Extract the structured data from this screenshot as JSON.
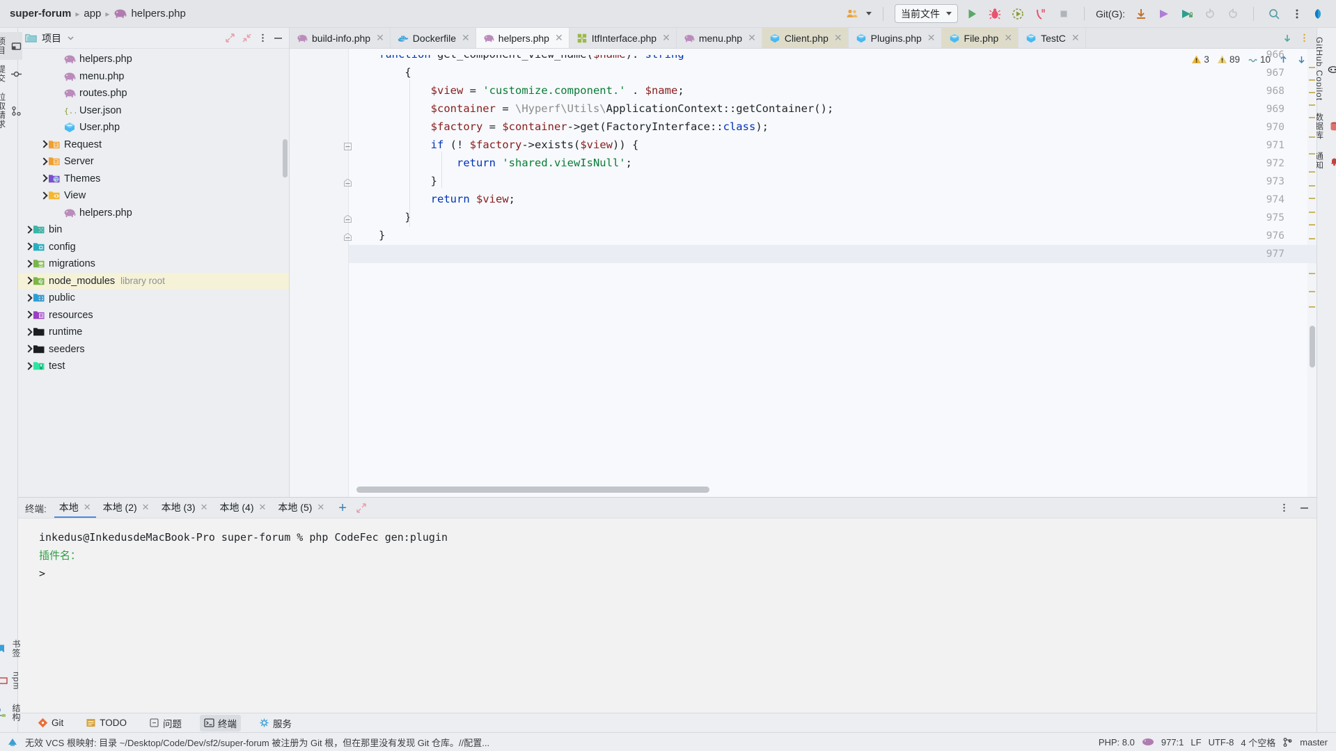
{
  "window": {
    "breadcrumb": [
      {
        "label": "super-forum",
        "icon": "",
        "bold": true
      },
      {
        "label": "app",
        "icon": "",
        "bold": false
      },
      {
        "label": "helpers.php",
        "icon": "php-elephant-icon",
        "bold": false
      }
    ]
  },
  "toolbar": {
    "run_config": "当前文件",
    "git_label": "Git(G):",
    "buttons": [
      {
        "name": "avatar-group-button",
        "icon": "people-icon"
      },
      {
        "name": "run-button",
        "icon": "play-icon"
      },
      {
        "name": "debug-button",
        "icon": "bug-icon"
      },
      {
        "name": "run-with-profiler-button",
        "icon": "profiler-icon"
      },
      {
        "name": "run-with-coverage-button",
        "icon": "coverage-icon"
      },
      {
        "name": "stop-button",
        "icon": "stop-icon"
      },
      {
        "name": "git-update-button",
        "icon": "download-arrow-icon"
      },
      {
        "name": "git-commit-button",
        "icon": "commit-arrow-icon"
      },
      {
        "name": "git-push-button",
        "icon": "push-arrow-icon"
      },
      {
        "name": "git-rollback-button",
        "icon": "undo-icon"
      },
      {
        "name": "git-redo-button",
        "icon": "redo-icon"
      },
      {
        "name": "search-everywhere-button",
        "icon": "search-icon"
      },
      {
        "name": "more-options-button",
        "icon": "kebab-menu-icon"
      },
      {
        "name": "ai-assistant-button",
        "icon": "assistant-icon"
      }
    ]
  },
  "left_rail": {
    "items": [
      {
        "label": "项目",
        "icon": "project-icon",
        "selected": true
      },
      {
        "label": "提交",
        "icon": "commit-icon",
        "selected": false
      },
      {
        "label": "拉取请求",
        "icon": "pull-request-icon",
        "selected": false
      }
    ],
    "bottom_items": [
      {
        "label": "书签",
        "icon": "bookmark-icon"
      },
      {
        "label": "npm",
        "icon": "npm-icon"
      },
      {
        "label": "结构",
        "icon": "structure-icon"
      }
    ]
  },
  "right_rail": {
    "items": [
      {
        "label": "GitHub Copilot",
        "icon": "copilot-icon"
      },
      {
        "label": "数据库",
        "icon": "database-icon"
      },
      {
        "label": "通知",
        "icon": "notifications-icon"
      }
    ]
  },
  "project": {
    "title": "项目",
    "tree": [
      {
        "label": "helpers.php",
        "icon": "php-elephant-icon",
        "indent": 3,
        "arrow": false,
        "note": ""
      },
      {
        "label": "menu.php",
        "icon": "php-elephant-icon",
        "indent": 3,
        "arrow": false,
        "note": ""
      },
      {
        "label": "routes.php",
        "icon": "php-elephant-icon",
        "indent": 3,
        "arrow": false,
        "note": ""
      },
      {
        "label": "User.json",
        "icon": "json-icon",
        "indent": 3,
        "arrow": false,
        "note": ""
      },
      {
        "label": "User.php",
        "icon": "php-class-icon",
        "indent": 3,
        "arrow": false,
        "note": ""
      },
      {
        "label": "Request",
        "icon": "folder-orange-icon",
        "indent": 2,
        "arrow": true,
        "note": ""
      },
      {
        "label": "Server",
        "icon": "folder-orange-icon",
        "indent": 2,
        "arrow": true,
        "note": ""
      },
      {
        "label": "Themes",
        "icon": "folder-purple-icon",
        "indent": 2,
        "arrow": true,
        "note": ""
      },
      {
        "label": "View",
        "icon": "folder-yellow-icon",
        "indent": 2,
        "arrow": true,
        "note": ""
      },
      {
        "label": "helpers.php",
        "icon": "php-elephant-icon",
        "indent": 3,
        "arrow": false,
        "note": ""
      },
      {
        "label": "bin",
        "icon": "folder-teal-icon",
        "indent": 1,
        "arrow": true,
        "note": ""
      },
      {
        "label": "config",
        "icon": "folder-config-icon",
        "indent": 1,
        "arrow": true,
        "note": ""
      },
      {
        "label": "migrations",
        "icon": "folder-green-icon",
        "indent": 1,
        "arrow": true,
        "note": ""
      },
      {
        "label": "node_modules",
        "icon": "folder-node-icon",
        "indent": 1,
        "arrow": true,
        "note": "library root",
        "highlighted": true
      },
      {
        "label": "public",
        "icon": "folder-blue-icon",
        "indent": 1,
        "arrow": true,
        "note": ""
      },
      {
        "label": "resources",
        "icon": "folder-violet-icon",
        "indent": 1,
        "arrow": true,
        "note": ""
      },
      {
        "label": "runtime",
        "icon": "folder-black-icon",
        "indent": 1,
        "arrow": true,
        "note": ""
      },
      {
        "label": "seeders",
        "icon": "folder-black-icon",
        "indent": 1,
        "arrow": true,
        "note": ""
      },
      {
        "label": "test",
        "icon": "folder-test-icon",
        "indent": 1,
        "arrow": true,
        "note": ""
      }
    ]
  },
  "editor": {
    "tabs": [
      {
        "label": "build-info.php",
        "icon": "php-elephant-icon",
        "active": false,
        "modified": false
      },
      {
        "label": "Dockerfile",
        "icon": "docker-icon",
        "active": false,
        "modified": false
      },
      {
        "label": "helpers.php",
        "icon": "php-elephant-icon",
        "active": true,
        "modified": false
      },
      {
        "label": "ItfInterface.php",
        "icon": "php-interface-icon",
        "active": false,
        "modified": false
      },
      {
        "label": "menu.php",
        "icon": "php-elephant-icon",
        "active": false,
        "modified": false
      },
      {
        "label": "Client.php",
        "icon": "php-class-icon",
        "active": false,
        "modified": true
      },
      {
        "label": "Plugins.php",
        "icon": "php-class-icon",
        "active": false,
        "modified": false
      },
      {
        "label": "File.php",
        "icon": "php-class-icon",
        "active": false,
        "modified": true
      },
      {
        "label": "TestC",
        "icon": "php-class-icon",
        "active": false,
        "modified": false
      }
    ],
    "inspections": {
      "warnings_strong": "3",
      "warnings_weak": "89",
      "weak_warnings": "10"
    },
    "lines": [
      {
        "num": "966",
        "clipped": true,
        "tokens": [
          {
            "t": "function ",
            "c": "c-kw"
          },
          {
            "t": "get_component_view_name",
            "c": "c-fn"
          },
          {
            "t": "(",
            "c": ""
          },
          {
            "t": "$name",
            "c": "c-var"
          },
          {
            "t": "): ",
            "c": ""
          },
          {
            "t": "string",
            "c": "c-kw"
          }
        ],
        "indent": 0
      },
      {
        "num": "967",
        "tokens": [
          {
            "t": "{",
            "c": ""
          }
        ],
        "indent": 1
      },
      {
        "num": "968",
        "tokens": [
          {
            "t": "$view",
            "c": "c-var"
          },
          {
            "t": " = ",
            "c": ""
          },
          {
            "t": "'customize.component.'",
            "c": "c-str"
          },
          {
            "t": " . ",
            "c": ""
          },
          {
            "t": "$name",
            "c": "c-var"
          },
          {
            "t": ";",
            "c": ""
          }
        ],
        "indent": 2
      },
      {
        "num": "969",
        "tokens": [
          {
            "t": "$container",
            "c": "c-var"
          },
          {
            "t": " = ",
            "c": ""
          },
          {
            "t": "\\Hyperf\\Utils\\",
            "c": "c-ns"
          },
          {
            "t": "ApplicationContext",
            "c": "c-cls"
          },
          {
            "t": "::",
            "c": ""
          },
          {
            "t": "getContainer",
            "c": "c-fn"
          },
          {
            "t": "();",
            "c": ""
          }
        ],
        "indent": 2
      },
      {
        "num": "970",
        "tokens": [
          {
            "t": "$factory",
            "c": "c-var"
          },
          {
            "t": " = ",
            "c": ""
          },
          {
            "t": "$container",
            "c": "c-var"
          },
          {
            "t": "->",
            "c": ""
          },
          {
            "t": "get",
            "c": "c-fn"
          },
          {
            "t": "(",
            "c": ""
          },
          {
            "t": "FactoryInterface",
            "c": "c-cls"
          },
          {
            "t": "::",
            "c": ""
          },
          {
            "t": "class",
            "c": "c-kw"
          },
          {
            "t": ");",
            "c": ""
          }
        ],
        "indent": 2
      },
      {
        "num": "971",
        "fold": "minus",
        "tokens": [
          {
            "t": "if",
            "c": "c-kw"
          },
          {
            "t": " (! ",
            "c": ""
          },
          {
            "t": "$factory",
            "c": "c-var"
          },
          {
            "t": "->",
            "c": ""
          },
          {
            "t": "exists",
            "c": "c-fn"
          },
          {
            "t": "(",
            "c": ""
          },
          {
            "t": "$view",
            "c": "c-var"
          },
          {
            "t": ")) {",
            "c": ""
          }
        ],
        "indent": 2
      },
      {
        "num": "972",
        "tokens": [
          {
            "t": "return",
            "c": "c-kw"
          },
          {
            "t": " ",
            "c": ""
          },
          {
            "t": "'shared.viewIsNull'",
            "c": "c-str"
          },
          {
            "t": ";",
            "c": ""
          }
        ],
        "indent": 3
      },
      {
        "num": "973",
        "fold": "end",
        "tokens": [
          {
            "t": "}",
            "c": ""
          }
        ],
        "indent": 2
      },
      {
        "num": "974",
        "tokens": [
          {
            "t": "return",
            "c": "c-kw"
          },
          {
            "t": " ",
            "c": ""
          },
          {
            "t": "$view",
            "c": "c-var"
          },
          {
            "t": ";",
            "c": ""
          }
        ],
        "indent": 2
      },
      {
        "num": "975",
        "fold": "end",
        "tokens": [
          {
            "t": "}",
            "c": ""
          }
        ],
        "indent": 1
      },
      {
        "num": "976",
        "fold": "end",
        "tokens": [
          {
            "t": "}",
            "c": ""
          }
        ],
        "indent": 0
      },
      {
        "num": "977",
        "tokens": [],
        "indent": 0,
        "current": true
      }
    ]
  },
  "terminal": {
    "label": "终端:",
    "tabs": [
      {
        "label": "本地",
        "active": true
      },
      {
        "label": "本地 (2)",
        "active": false
      },
      {
        "label": "本地 (3)",
        "active": false
      },
      {
        "label": "本地 (4)",
        "active": false
      },
      {
        "label": "本地 (5)",
        "active": false
      }
    ],
    "add_tab_label": "+",
    "content": {
      "prompt_line": "inkedus@InkedusdeMacBook-Pro super-forum % php CodeFec gen:plugin",
      "blank": "",
      "question": "插件名：",
      "cursor_line": ">"
    }
  },
  "tool_strip": {
    "items": [
      {
        "label": "Git",
        "icon": "git-icon",
        "selected": false
      },
      {
        "label": "TODO",
        "icon": "todo-icon",
        "selected": false
      },
      {
        "label": "问题",
        "icon": "problems-icon",
        "selected": false
      },
      {
        "label": "终端",
        "icon": "terminal-icon",
        "selected": true
      },
      {
        "label": "服务",
        "icon": "services-icon",
        "selected": false
      }
    ]
  },
  "status_bar": {
    "message": "无效 VCS 根映射: 目录 ~/Desktop/Code/Dev/sf2/super-forum 被注册为 Git 根，但在那里没有发现 Git 仓库。//配置...",
    "php_version": "PHP: 8.0",
    "caret": "977:1",
    "line_sep": "LF",
    "encoding": "UTF-8",
    "indent": "4 个空格",
    "branch": "master"
  }
}
